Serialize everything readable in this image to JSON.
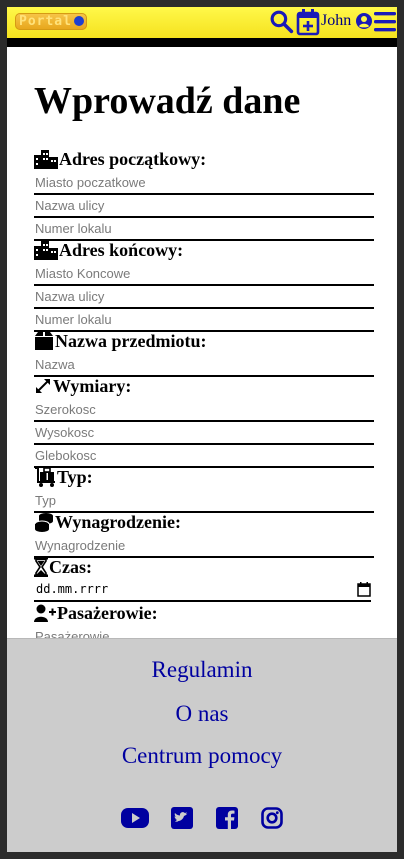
{
  "header": {
    "logo_text": "Portal",
    "user_name": "John",
    "icons": [
      "search-icon",
      "calendar-plus-icon",
      "user-circle-icon",
      "hamburger-menu-icon"
    ],
    "accent_color": "#1a1ab8",
    "bar_color": "#f5e21e"
  },
  "form": {
    "title": "Wprowadź dane",
    "start_address": {
      "label": "Adres początkowy:",
      "city_placeholder": "Miasto poczatkowe",
      "street_placeholder": "Nazwa ulicy",
      "unit_placeholder": "Numer lokalu"
    },
    "end_address": {
      "label": "Adres końcowy:",
      "city_placeholder": "Miasto Koncowe",
      "street_placeholder": "Nazwa ulicy",
      "unit_placeholder": "Numer lokalu"
    },
    "item_name": {
      "label": "Nazwa przedmiotu:",
      "placeholder": "Nazwa"
    },
    "dimensions": {
      "label": "Wymiary:",
      "width_placeholder": "Szerokosc",
      "height_placeholder": "Wysokosc",
      "depth_placeholder": "Glebokosc"
    },
    "type": {
      "label": "Typ:",
      "placeholder": "Typ"
    },
    "pay": {
      "label": "Wynagrodzenie:",
      "placeholder": "Wynagrodzenie"
    },
    "time": {
      "label": "Czas:",
      "date_value": "dd.mm.rrrr"
    },
    "passengers": {
      "label": "Pasażerowie:",
      "placeholder": "Pasażerowie"
    }
  },
  "footer": {
    "links": [
      "Regulamin",
      "O nas",
      "Centrum pomocy"
    ],
    "social_icons": [
      "youtube-icon",
      "twitter-icon",
      "facebook-icon",
      "instagram-icon"
    ],
    "link_color": "#0000a0",
    "background": "#cccccc"
  }
}
